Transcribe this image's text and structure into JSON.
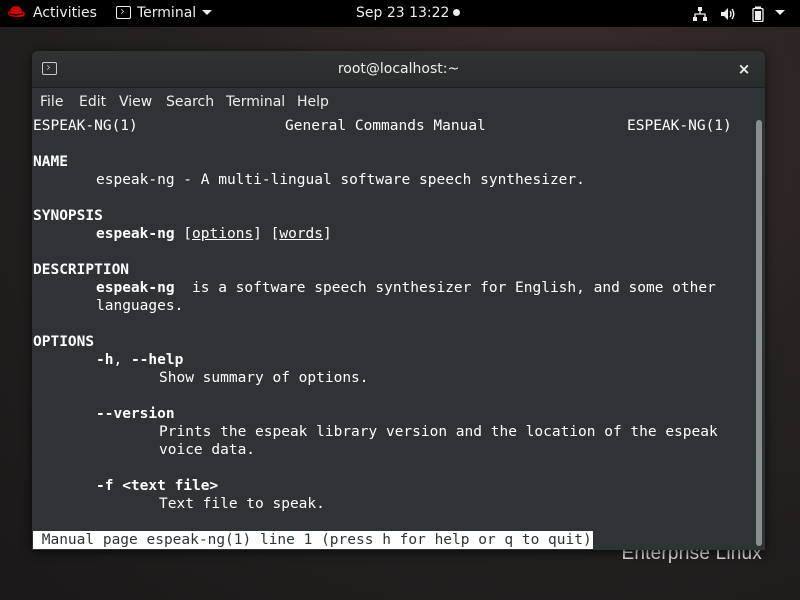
{
  "topbar": {
    "activities": "Activities",
    "app_menu": "Terminal",
    "clock": "Sep 23  13:22",
    "icons": {
      "logo": "redhat-logo-icon",
      "network": "network-wired-icon",
      "volume": "volume-icon",
      "battery": "battery-icon",
      "system": "system-menu-caret-icon"
    }
  },
  "desktop": {
    "brand_text": "Enterprise Linux"
  },
  "window": {
    "title": "root@localhost:~",
    "close_label": "×"
  },
  "menubar": {
    "items": [
      "File",
      "Edit",
      "View",
      "Search",
      "Terminal",
      "Help"
    ]
  },
  "man": {
    "header_left": "ESPEAK-NG(1)",
    "header_center": "General Commands Manual",
    "header_right": "ESPEAK-NG(1)",
    "name_heading": "NAME",
    "name_text": "espeak-ng - A multi-lingual software speech synthesizer.",
    "synopsis_heading": "SYNOPSIS",
    "synopsis_cmd": "espeak-ng",
    "synopsis_options": "options",
    "synopsis_words": "words",
    "description_heading": "DESCRIPTION",
    "description_cmd": "espeak-ng",
    "description_rest": "  is a software speech synthesizer for English, and some other",
    "description_line2": "languages.",
    "options_heading": "OPTIONS",
    "opt1_flag_a": "-h",
    "opt1_sep": ", ",
    "opt1_flag_b": "--help",
    "opt1_desc": "Show summary of options.",
    "opt2_flag": "--version",
    "opt2_desc1": "Prints the espeak library version and the location of the espeak",
    "opt2_desc2": "voice data.",
    "opt3_flag": "-f <text file>",
    "opt3_desc": "Text file to speak.",
    "status_line": " Manual page espeak-ng(1) line 1 (press h for help or q to quit)"
  },
  "colors": {
    "terminal_bg": "#2e3436",
    "terminal_fg": "#ffffff",
    "topbar_bg": "#000000"
  }
}
